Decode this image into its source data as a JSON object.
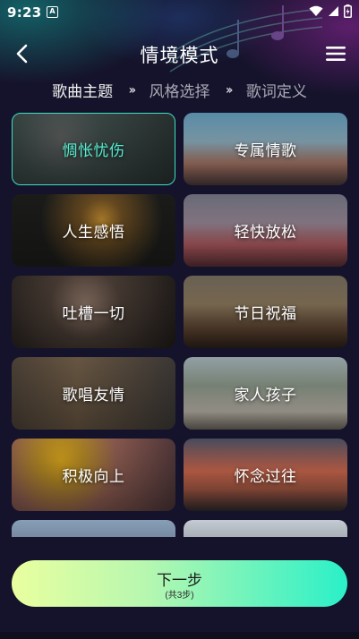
{
  "status_bar": {
    "time": "9:23",
    "notification_badge": "A",
    "icons": [
      "wifi-icon",
      "signal-icon",
      "battery-charging-icon"
    ]
  },
  "header": {
    "title": "情境模式",
    "back_icon": "chevron-left-icon",
    "menu_icon": "hamburger-menu-icon"
  },
  "steps": [
    {
      "label": "歌曲主题",
      "active": true
    },
    {
      "label": "风格选择",
      "active": false
    },
    {
      "label": "歌词定义",
      "active": false
    }
  ],
  "step_separator": "››",
  "themes": [
    {
      "label": "惆怅忧伤",
      "selected": true
    },
    {
      "label": "专属情歌",
      "selected": false
    },
    {
      "label": "人生感悟",
      "selected": false
    },
    {
      "label": "轻快放松",
      "selected": false
    },
    {
      "label": "吐槽一切",
      "selected": false
    },
    {
      "label": "节日祝福",
      "selected": false
    },
    {
      "label": "歌唱友情",
      "selected": false
    },
    {
      "label": "家人孩子",
      "selected": false
    },
    {
      "label": "积极向上",
      "selected": false
    },
    {
      "label": "怀念过往",
      "selected": false
    }
  ],
  "next_button": {
    "label": "下一步",
    "sub_label": "(共3步)"
  },
  "colors": {
    "accent": "#3de0c4",
    "button_gradient_start": "#e9ff9f",
    "button_gradient_end": "#2af0c8",
    "background": "#15132b"
  }
}
